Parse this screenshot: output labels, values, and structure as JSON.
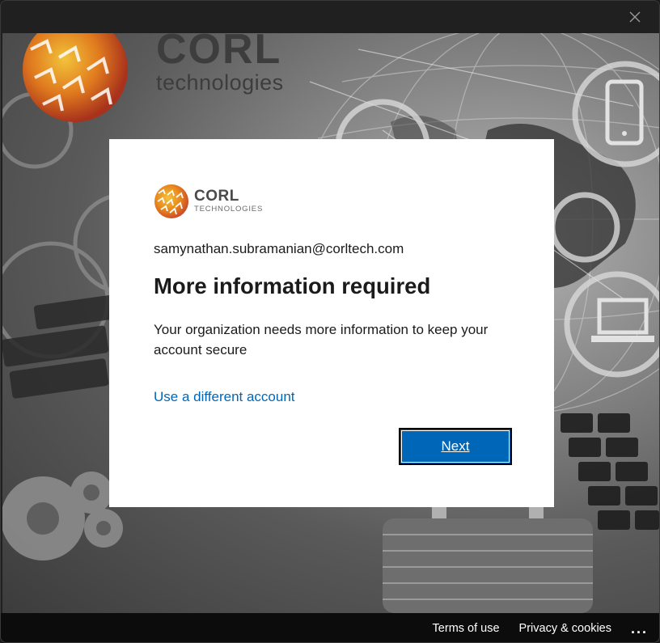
{
  "window": {
    "close_label": "×"
  },
  "background": {
    "brand_name": "CORL",
    "brand_tagline": "technologies"
  },
  "dialog": {
    "logo": {
      "name": "CORL",
      "tagline": "TECHNOLOGIES"
    },
    "email": "samynathan.subramanian@corltech.com",
    "title": "More information required",
    "description": "Your organization needs more information to keep your account secure",
    "alt_account_link": "Use a different account",
    "next_button": "Next"
  },
  "footer": {
    "terms": "Terms of use",
    "privacy": "Privacy & cookies",
    "more": "..."
  },
  "colors": {
    "accent": "#0067b8",
    "link": "#0067b8",
    "logo_orange": "#e8891d",
    "logo_red": "#c8442a"
  }
}
